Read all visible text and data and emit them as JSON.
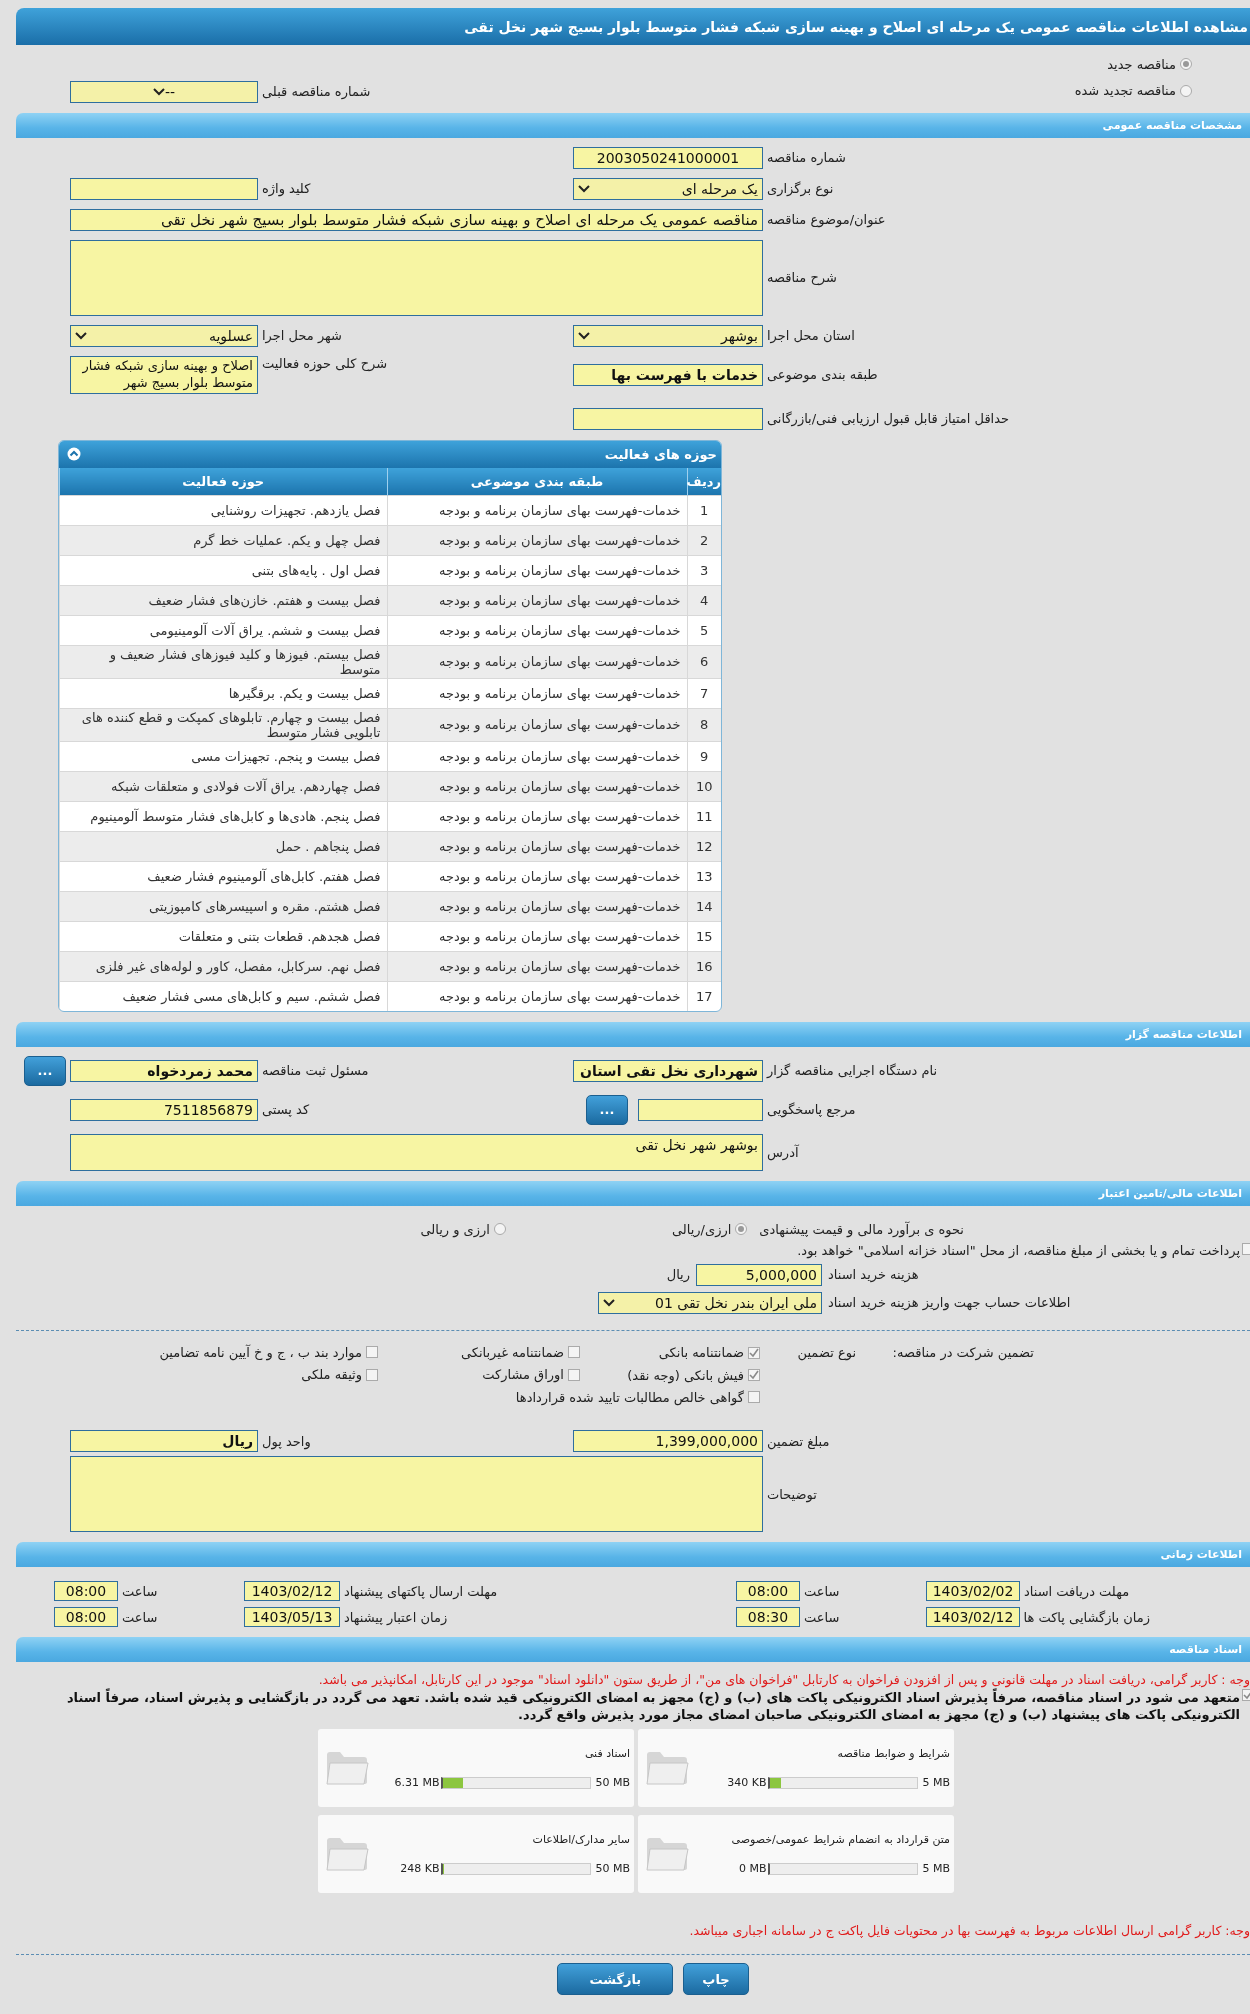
{
  "title": "مشاهده اطلاعات مناقصه عمومی یک مرحله ای اصلاح و بهینه سازی شبکه فشار متوسط بلوار بسیج شهر نخل تقی",
  "tender_type": [
    {
      "label": "مناقصه جدید",
      "selected": true
    },
    {
      "label": "مناقصه تجدید شده",
      "selected": false
    }
  ],
  "previous_tender": {
    "label": "شماره مناقصه قبلی",
    "kind": "select",
    "value": "--",
    "bold": false
  },
  "general": {
    "title": "مشخصات مناقصه عمومی",
    "rows": [
      [
        {
          "label": "شماره مناقصه",
          "kind": "text",
          "value": "2003050241000001",
          "bold": false
        }
      ],
      [
        {
          "label": "نوع برگزاری",
          "kind": "select",
          "value": "یک مرحله ای",
          "bold": false
        },
        {
          "label": "کلید واژه",
          "kind": "text"
        }
      ],
      [
        {
          "label": "عنوان/موضوع مناقصه",
          "kind": "wide",
          "value": "مناقصه عمومی یک مرحله ای اصلاح و بهینه سازی شبکه فشار متوسط بلوار بسیج شهر نخل تقی",
          "bold": false
        }
      ],
      [
        {
          "label": "شرح مناقصه",
          "kind": "textarea"
        }
      ],
      [
        {
          "label": "استان محل اجرا",
          "kind": "select",
          "value": "بوشهر",
          "bold": false
        },
        {
          "label": "شهر محل اجرا",
          "kind": "select",
          "value": "عسلویه",
          "bold": false
        }
      ],
      [
        {
          "label": "طبقه بندی موضوعی",
          "kind": "text",
          "value": "خدمات با فهرست بها",
          "bold": true
        },
        {
          "label": "شرح کلی حوزه فعالیت",
          "kind": "multiline",
          "value": "اصلاح و بهینه سازی شبکه فشار متوسط بلوار بسیج شهر",
          "bold": false
        }
      ],
      [
        {
          "label": "حداقل امتیاز قابل قبول ارزیابی فنی/بازرگانی",
          "kind": "text"
        }
      ]
    ]
  },
  "activities": {
    "title": "حوزه های فعالیت",
    "columns": [
      "ردیف",
      "طبقه بندی موضوعی",
      "حوزه فعالیت"
    ],
    "rows": [
      {
        "row": "1",
        "category": "خدمات-فهرست بهای سازمان برنامه و بودجه",
        "activity": "فصل یازدهم. تجهیزات روشنایی"
      },
      {
        "row": "2",
        "category": "خدمات-فهرست بهای سازمان برنامه و بودجه",
        "activity": "فصل چهل و یکم. عملیات خط گرم"
      },
      {
        "row": "3",
        "category": "خدمات-فهرست بهای سازمان برنامه و بودجه",
        "activity": "فصل اول . پایه‌های بتنی"
      },
      {
        "row": "4",
        "category": "خدمات-فهرست بهای سازمان برنامه و بودجه",
        "activity": "فصل بیست و هفتم. خازن‌های فشار ضعیف"
      },
      {
        "row": "5",
        "category": "خدمات-فهرست بهای سازمان برنامه و بودجه",
        "activity": "فصل بیست و ششم. یراق آلات آلومینیومی"
      },
      {
        "row": "6",
        "category": "خدمات-فهرست بهای سازمان برنامه و بودجه",
        "activity": "فصل بیستم. فیوزها و کلید فیوزهای فشار ضعیف و متوسط"
      },
      {
        "row": "7",
        "category": "خدمات-فهرست بهای سازمان برنامه و بودجه",
        "activity": "فصل بیست و یکم. برقگیرها"
      },
      {
        "row": "8",
        "category": "خدمات-فهرست بهای سازمان برنامه و بودجه",
        "activity": "فصل بیست و چهارم. تابلوهای کمپکت و قطع کننده های تابلویی فشار متوسط"
      },
      {
        "row": "9",
        "category": "خدمات-فهرست بهای سازمان برنامه و بودجه",
        "activity": "فصل بیست و پنجم. تجهیزات مسی"
      },
      {
        "row": "10",
        "category": "خدمات-فهرست بهای سازمان برنامه و بودجه",
        "activity": "فصل چهاردهم. یراق آلات فولادی و متعلقات شبکه"
      },
      {
        "row": "11",
        "category": "خدمات-فهرست بهای سازمان برنامه و بودجه",
        "activity": "فصل پنجم. هادی‌ها و کابل‌های فشار متوسط آلومینیوم"
      },
      {
        "row": "12",
        "category": "خدمات-فهرست بهای سازمان برنامه و بودجه",
        "activity": "فصل پنجاهم . حمل"
      },
      {
        "row": "13",
        "category": "خدمات-فهرست بهای سازمان برنامه و بودجه",
        "activity": "فصل هفتم. کابل‌های آلومینیوم فشار ضعیف"
      },
      {
        "row": "14",
        "category": "خدمات-فهرست بهای سازمان برنامه و بودجه",
        "activity": "فصل هشتم. مقره و اسپیسرهای کامپوزیتی"
      },
      {
        "row": "15",
        "category": "خدمات-فهرست بهای سازمان برنامه و بودجه",
        "activity": "فصل هجدهم. قطعات بتنی و متعلقات"
      },
      {
        "row": "16",
        "category": "خدمات-فهرست بهای سازمان برنامه و بودجه",
        "activity": "فصل نهم. سرکابل، مفصل، کاور و لوله‌های غیر فلزی"
      },
      {
        "row": "17",
        "category": "خدمات-فهرست بهای سازمان برنامه و بودجه",
        "activity": "فصل ششم. سیم و کابل‌های مسی فشار ضعیف"
      }
    ]
  },
  "employer": {
    "title": "اطلاعات مناقصه گزار",
    "rows": [
      [
        {
          "label": "نام دستگاه اجرایی مناقصه گزار",
          "kind": "text",
          "value": "شهرداری نخل تقی استان",
          "bold": true
        },
        {
          "label": "مسئول ثبت مناقصه",
          "kind": "text",
          "value": "محمد زمردخواه",
          "bold": true,
          "button": "..."
        }
      ],
      [
        {
          "label": "مرجع پاسخگویی",
          "kind": "text",
          "button": "..."
        },
        {
          "label": "کد پستی",
          "kind": "text",
          "value": "7511856879",
          "bold": false
        }
      ],
      [
        {
          "label": "آدرس",
          "kind": "address",
          "value": "بوشهر شهر نخل تقی",
          "bold": false
        }
      ]
    ]
  },
  "finance": {
    "title": "اطلاعات مالی/تامین اعتبار",
    "estimate": {
      "label": "نحوه ی برآورد مالی و قیمت پیشنهادی",
      "options": [
        {
          "label": "ارزی/ریالی",
          "selected": true
        },
        {
          "label": "ارزی و ریالی",
          "selected": false
        }
      ]
    },
    "treasury": {
      "label": "پرداخت تمام و یا بخشی از مبلغ مناقصه، از محل \"اسناد خزانه اسلامی\" خواهد بود.",
      "checked": false
    },
    "document_fee": {
      "label": "هزینه خرید اسناد",
      "value": "5,000,000",
      "unit": "ریال"
    },
    "account": {
      "label": "اطلاعات حساب جهت واریز هزینه خرید اسناد",
      "value": "ملی ایران بندر نخل تقی 01"
    }
  },
  "guarantee": {
    "label": "تضمین شرکت در مناقصه:",
    "type_label": "نوع تضمین",
    "options": [
      {
        "label": "ضمانتنامه بانکی",
        "checked": true
      },
      {
        "label": "ضمانتنامه غیربانکی",
        "checked": false
      },
      {
        "label": "موارد بند ب ، ج و خ آیین نامه تضامین",
        "checked": false
      },
      {
        "label": "فیش بانکی (وجه نقد)",
        "checked": true
      },
      {
        "label": "اوراق مشارکت",
        "checked": false
      },
      {
        "label": "وثیقه ملکی",
        "checked": false
      },
      {
        "label": "گواهی خالص مطالبات تایید شده قراردادها",
        "checked": false
      }
    ],
    "rows": [
      [
        {
          "label": "مبلغ تضمین",
          "kind": "text",
          "value": "1,399,000,000",
          "bold": false
        },
        {
          "label": "واحد پول",
          "kind": "text",
          "value": "ریال",
          "bold": true
        }
      ],
      [
        {
          "label": "توضیحات",
          "kind": "textarea"
        }
      ]
    ]
  },
  "schedule": {
    "title": "اطلاعات زمانی",
    "items": [
      {
        "label": "مهلت دریافت اسناد",
        "date": "1403/02/02",
        "time_label": "ساعت",
        "time": "08:00"
      },
      {
        "label": "مهلت ارسال پاکتهای پیشنهاد",
        "date": "1403/02/12",
        "time_label": "ساعت",
        "time": "08:00"
      },
      {
        "label": "زمان بازگشایی پاکت ها",
        "date": "1403/02/12",
        "time_label": "ساعت",
        "time": "08:30"
      },
      {
        "label": "زمان اعتبار پیشنهاد",
        "date": "1403/05/13",
        "time_label": "ساعت",
        "time": "08:00"
      }
    ]
  },
  "documents": {
    "title": "اسناد مناقصه",
    "notice": "وجه : کاربر گرامی، دریافت اسناد در مهلت قانونی و پس از افزودن فراخوان به کارتابل \"فراخوان های من\"، از طریق ستون \"دانلود اسناد\" موجود در این کارتابل، امکانپذیر می باشد.",
    "pledge": {
      "checked": true,
      "text": "متعهد می شود در اسناد مناقصه، صرفاً پذیرش اسناد الکترونیکی پاکت های (ب) و (ج) مجهز به امضای الکترونیکی قید شده باشد. تعهد می گردد در بازگشایی و پذیرش اسناد، صرفاً اسناد الکترونیکی پاکت های پیشنهاد (ب) و (ج) مجهز به امضای الکترونیکی صاحبان امضای مجاز مورد پذیرش واقع گردد."
    },
    "items": [
      {
        "title": "شرایط و ضوابط مناقصه",
        "size": "340 KB",
        "max": "5 MB",
        "level": 0.07
      },
      {
        "title": "اسناد فنی",
        "size": "6.31 MB",
        "max": "50 MB",
        "level": 0.13
      },
      {
        "title": "متن قرارداد به انضمام شرایط عمومی/خصوصی",
        "size": "0 MB",
        "max": "5 MB",
        "level": 0
      },
      {
        "title": "سایر مدارک/اطلاعات",
        "size": "248 KB",
        "max": "50 MB",
        "level": 0.005
      }
    ],
    "footer_note": "وجه: کاربر گرامی ارسال اطلاعات مربوط به فهرست بها در محتویات فایل پاکت ج در سامانه اجباری میباشد."
  },
  "buttons": [
    "چاپ",
    "بازگشت"
  ]
}
